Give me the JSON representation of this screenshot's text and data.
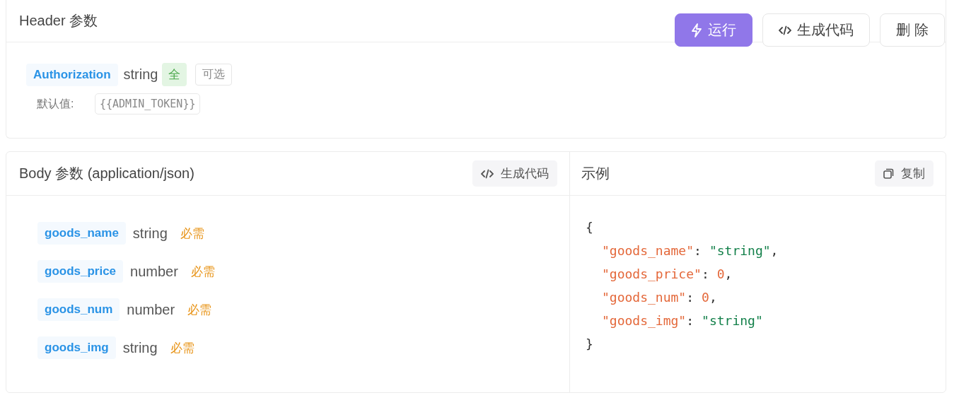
{
  "toolbar": {
    "buttons": [
      {
        "label": "运行",
        "kind": "run"
      },
      {
        "label": "生成代码",
        "kind": "code"
      },
      {
        "label": "删 除",
        "kind": "delete"
      }
    ]
  },
  "header_section": {
    "title": "Header 参数",
    "params": [
      {
        "name": "Authorization",
        "type": "string",
        "scope_tag": "全",
        "optional_tag": "可选",
        "default_label": "默认值:",
        "default_value": "{{ADMIN_TOKEN}}"
      }
    ]
  },
  "body_section": {
    "title": "Body 参数 (application/json)",
    "generate_button": "生成代码",
    "params": [
      {
        "name": "goods_name",
        "type": "string",
        "required": "必需"
      },
      {
        "name": "goods_price",
        "type": "number",
        "required": "必需"
      },
      {
        "name": "goods_num",
        "type": "number",
        "required": "必需"
      },
      {
        "name": "goods_img",
        "type": "string",
        "required": "必需"
      }
    ]
  },
  "example": {
    "title": "示例",
    "copy_button": "复制",
    "code": {
      "open": "{",
      "close": "}",
      "entries": [
        {
          "key": "\"goods_name\"",
          "colon": ":",
          "value": "\"string\"",
          "kind": "string",
          "comma": ","
        },
        {
          "key": "\"goods_price\"",
          "colon": ":",
          "value": "0",
          "kind": "number",
          "comma": ","
        },
        {
          "key": "\"goods_num\"",
          "colon": ":",
          "value": "0",
          "kind": "number",
          "comma": ","
        },
        {
          "key": "\"goods_img\"",
          "colon": ":",
          "value": "\"string\"",
          "kind": "string"
        }
      ]
    }
  }
}
